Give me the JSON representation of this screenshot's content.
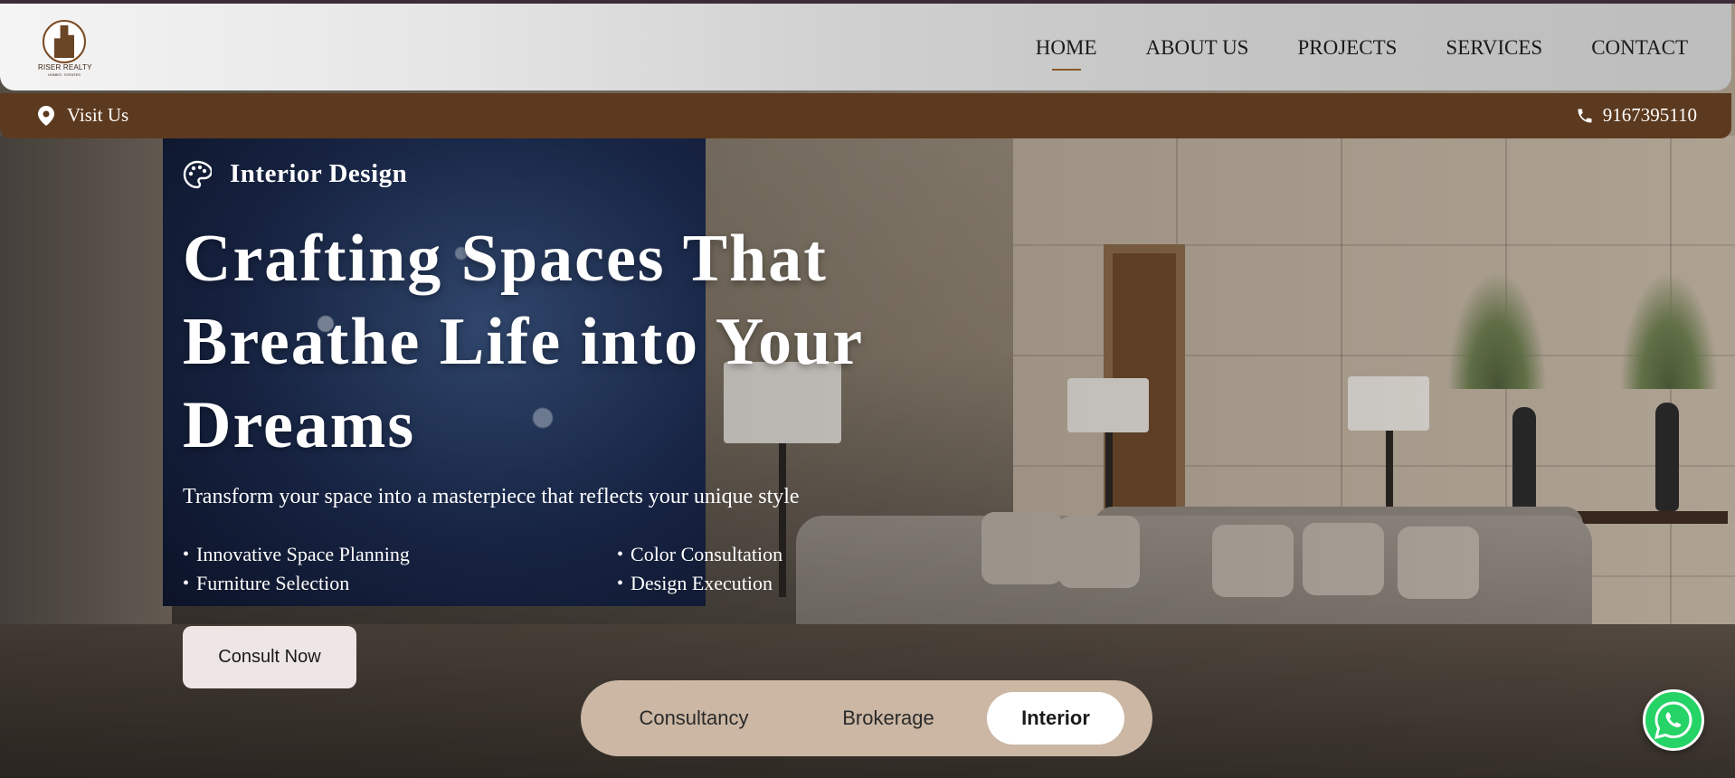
{
  "brand": {
    "name": "RISER REALTY",
    "sub": "HOMES · ESTATES"
  },
  "nav": {
    "items": [
      {
        "label": "HOME",
        "active": true
      },
      {
        "label": "ABOUT US",
        "active": false
      },
      {
        "label": "PROJECTS",
        "active": false
      },
      {
        "label": "SERVICES",
        "active": false
      },
      {
        "label": "CONTACT",
        "active": false
      }
    ]
  },
  "infobar": {
    "visit_label": "Visit Us",
    "phone": "9167395110"
  },
  "hero": {
    "badge": "Interior Design",
    "headline": "Crafting Spaces That Breathe Life into Your Dreams",
    "subline": "Transform your space into a masterpiece that reflects your unique style",
    "features": [
      "Innovative Space Planning",
      "Color Consultation",
      "Furniture Selection",
      "Design Execution"
    ],
    "cta": "Consult Now"
  },
  "tabs": {
    "items": [
      "Consultancy",
      "Brokerage",
      "Interior"
    ],
    "active": "Interior"
  },
  "colors": {
    "brown_bar": "#5c3a1f",
    "accent": "#8a5a2a",
    "tab_bg": "#cbb7a4",
    "whatsapp": "#25d366"
  }
}
